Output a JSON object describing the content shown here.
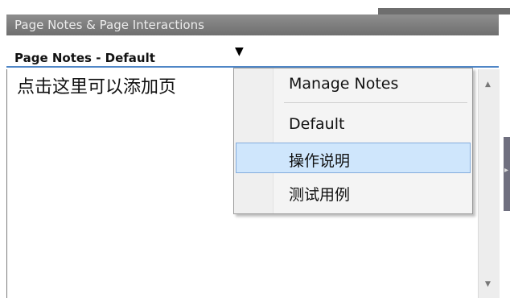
{
  "panel": {
    "title": "Page Notes & Page Interactions"
  },
  "notes_header": {
    "title": "Page Notes - Default",
    "arrow": "▼"
  },
  "notes": {
    "text": "点击这里可以添加页"
  },
  "scrollbar": {
    "up": "▲",
    "down": "▼"
  },
  "side_tab": {
    "arrow": "▸"
  },
  "menu": {
    "manage": "Manage Notes",
    "items": [
      "Default",
      "操作说明",
      "测试用例"
    ],
    "highlighted_index": 1
  },
  "colors": {
    "accent": "#4f86c6",
    "highlight": "#cfe6fc",
    "title_bar": "#7f7f7f"
  }
}
